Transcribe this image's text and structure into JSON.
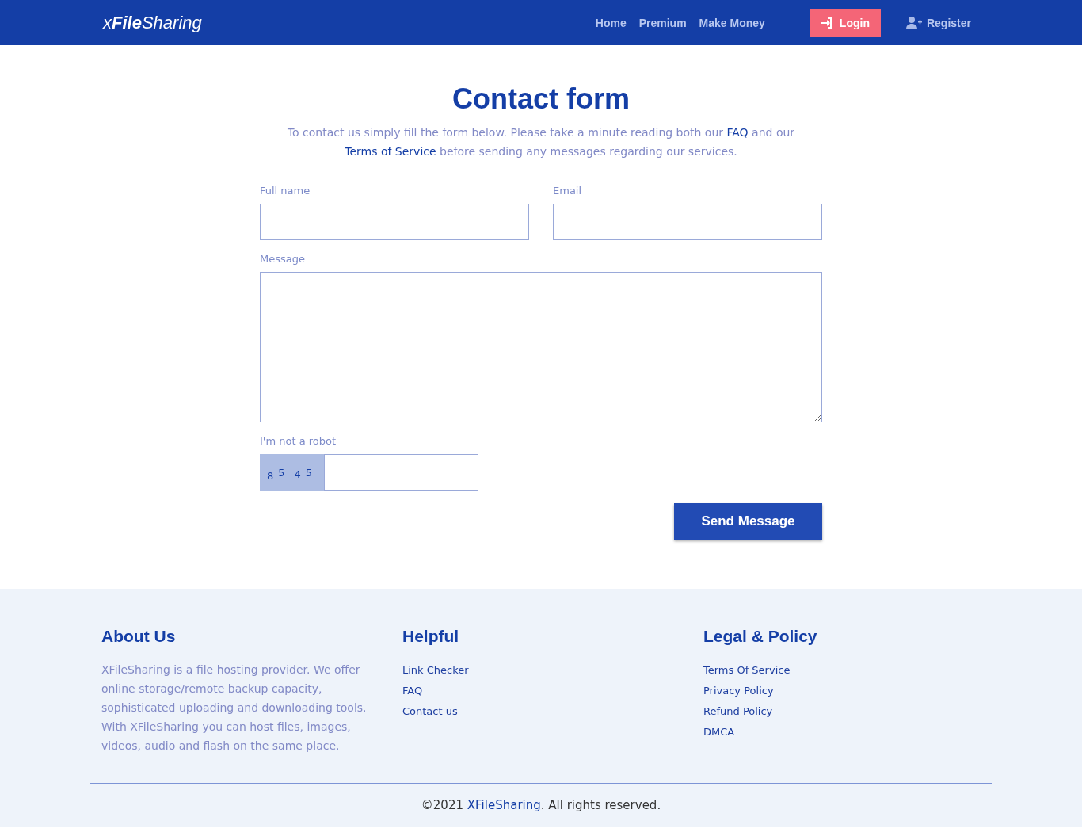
{
  "header": {
    "logo": [
      {
        "text": "x",
        "bold": false
      },
      {
        "text": "File",
        "bold": true
      },
      {
        "text": "Sharing",
        "bold": false
      }
    ],
    "nav": [
      "Home",
      "Premium",
      "Make Money"
    ],
    "login": {
      "label": "Login"
    },
    "register": {
      "label": "Register"
    }
  },
  "contact": {
    "title": "Contact form",
    "intro": [
      {
        "text": "To contact us simply fill the form below. Please take a minute reading both our ",
        "link": false
      },
      {
        "text": "FAQ",
        "link": true
      },
      {
        "text": " and our ",
        "link": false
      },
      {
        "text": "Terms of Service",
        "link": true
      },
      {
        "text": " before sending any messages regarding our services.",
        "link": false
      }
    ],
    "fields": [
      {
        "label": "Full name",
        "kind": "input"
      },
      {
        "label": "Email",
        "kind": "input"
      },
      {
        "label": "Message",
        "kind": "textarea"
      }
    ],
    "captcha": {
      "label": "I'm not a robot",
      "digits": [
        "8",
        "5",
        "4",
        "5"
      ]
    },
    "submit": "Send Message"
  },
  "footer": {
    "about": {
      "title": "About Us",
      "text": "XFileSharing is a file hosting provider. We offer online storage/remote backup capacity, sophisticated uploading and downloading tools. With XFileSharing you can host files, images, videos, audio and flash on the same place."
    },
    "columns": [
      {
        "title": "Helpful",
        "links": [
          "Link Checker",
          "FAQ",
          "Contact us"
        ]
      },
      {
        "title": "Legal & Policy",
        "links": [
          "Terms Of Service",
          "Privacy Policy",
          "Refund Policy",
          "DMCA"
        ]
      }
    ],
    "copyright": [
      {
        "text": "©2021 ",
        "link": false
      },
      {
        "text": "XFileSharing",
        "link": true
      },
      {
        "text": ". All rights reserved.",
        "link": false
      }
    ]
  }
}
